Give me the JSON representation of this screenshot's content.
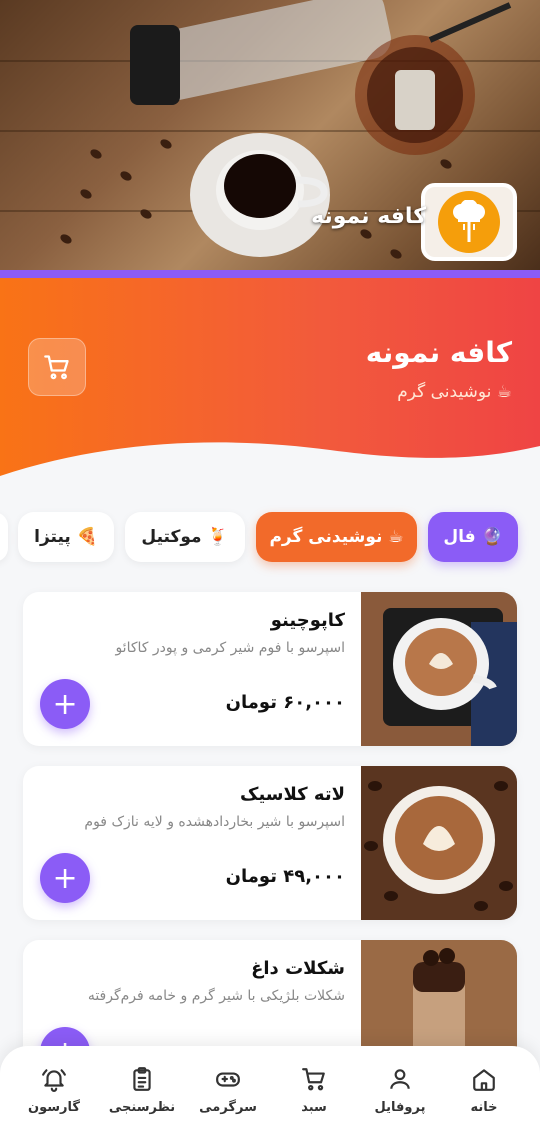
{
  "hero": {
    "cafe_name": "کافه نمونه",
    "logo_icon": "chef-hat-fork-icon"
  },
  "header": {
    "title": "کافه نمونه",
    "subtitle": "☕ نوشیدنی گرم",
    "cart_icon": "cart-icon"
  },
  "categories": [
    {
      "label": "🔮 فال",
      "style": "purple"
    },
    {
      "label": "☕ نوشیدنی گرم",
      "style": "orange"
    },
    {
      "label": "🍹 موکتیل",
      "style": "white"
    },
    {
      "label": "🍕 پیتزا",
      "style": "white"
    }
  ],
  "products": [
    {
      "name": "کاپوچینو",
      "desc": "اسپرسو با فوم شیر کرمی و پودر کاکائو",
      "price": "۶۰,۰۰۰ تومان"
    },
    {
      "name": "لاته کلاسیک",
      "desc": "اسپرسو با شیر بخاردادهشده و لایه نازک فوم",
      "price": "۴۹,۰۰۰ تومان"
    },
    {
      "name": "شکلات داغ",
      "desc": "شکلات بلژیکی با شیر گرم و خامه فرم‌گرفته",
      "price": ""
    }
  ],
  "nav": [
    {
      "label": "خانه",
      "icon": "home-icon"
    },
    {
      "label": "پروفایل",
      "icon": "user-icon"
    },
    {
      "label": "سبد",
      "icon": "cart-icon"
    },
    {
      "label": "سرگرمی",
      "icon": "gamepad-icon"
    },
    {
      "label": "نظرسنجی",
      "icon": "clipboard-icon"
    },
    {
      "label": "گارسون",
      "icon": "bell-icon"
    }
  ],
  "colors": {
    "purple": "#8b5cf6",
    "orange": "#f26a2a",
    "band_start": "#f97316",
    "band_end": "#ef4444"
  }
}
